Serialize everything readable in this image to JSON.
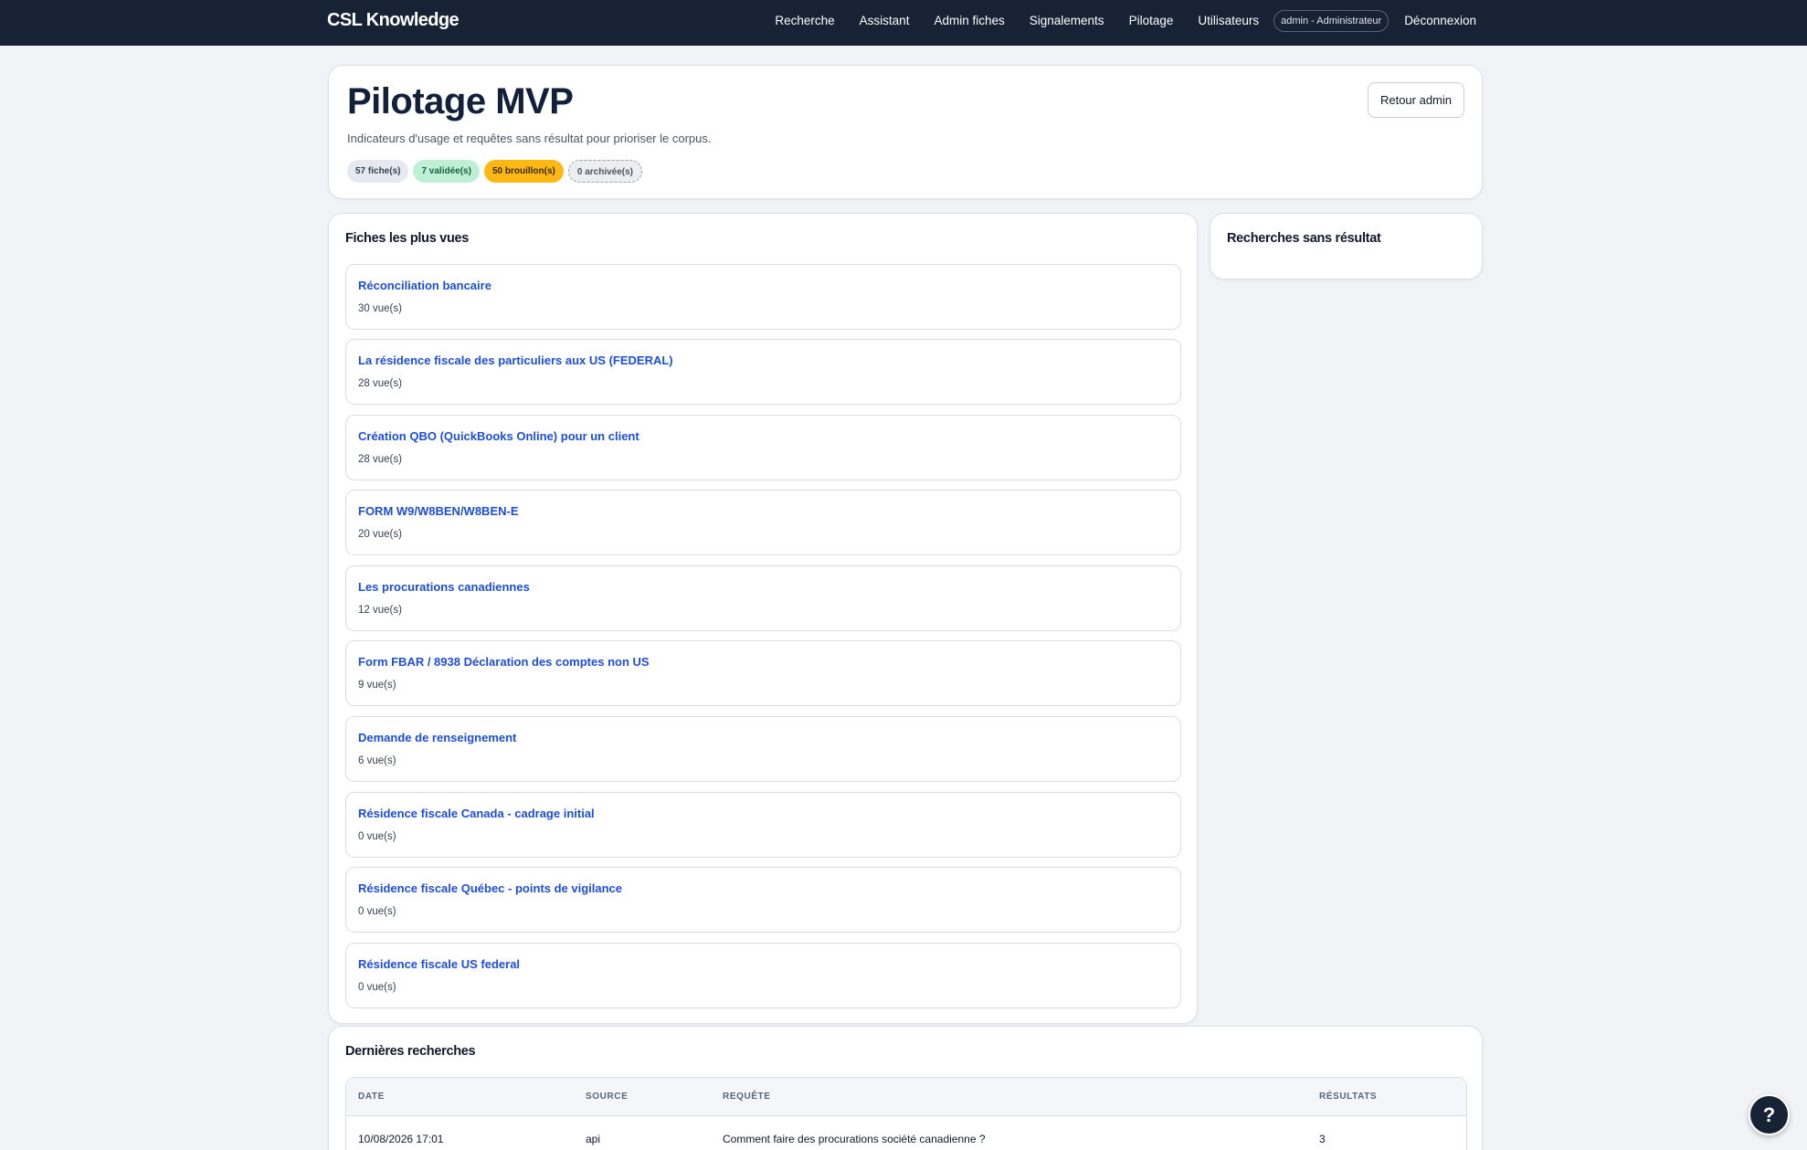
{
  "app": {
    "brand": "CSL Knowledge"
  },
  "nav": {
    "items": [
      "Recherche",
      "Assistant",
      "Admin fiches",
      "Signalements",
      "Pilotage",
      "Utilisateurs"
    ],
    "user": "admin - Administrateur",
    "logout": "Déconnexion"
  },
  "hero": {
    "title": "Pilotage MVP",
    "subtitle": "Indicateurs d'usage et requêtes sans résultat pour prioriser le corpus.",
    "back_label": "Retour admin",
    "badges": {
      "total": "57 fiche(s)",
      "validated": "7 validée(s)",
      "drafts": "50 brouillon(s)",
      "archived": "0 archivée(s)"
    }
  },
  "most_viewed": {
    "title": "Fiches les plus vues",
    "items": [
      {
        "title": "Réconciliation bancaire",
        "views": "30 vue(s)"
      },
      {
        "title": "La résidence fiscale des particuliers aux US (FEDERAL)",
        "views": "28 vue(s)"
      },
      {
        "title": "Création QBO (QuickBooks Online) pour un client",
        "views": "28 vue(s)"
      },
      {
        "title": "FORM W9/W8BEN/W8BEN-E",
        "views": "20 vue(s)"
      },
      {
        "title": "Les procurations canadiennes",
        "views": "12 vue(s)"
      },
      {
        "title": "Form FBAR / 8938 Déclaration des comptes non US",
        "views": "9 vue(s)"
      },
      {
        "title": "Demande de renseignement",
        "views": "6 vue(s)"
      },
      {
        "title": "Résidence fiscale Canada - cadrage initial",
        "views": "0 vue(s)"
      },
      {
        "title": "Résidence fiscale Québec - points de vigilance",
        "views": "0 vue(s)"
      },
      {
        "title": "Résidence fiscale US federal",
        "views": "0 vue(s)"
      }
    ]
  },
  "no_result": {
    "title": "Recherches sans résultat"
  },
  "recent": {
    "title": "Dernières recherches",
    "headers": {
      "date": "DATE",
      "source": "SOURCE",
      "query": "REQUÊTE",
      "results": "RÉSULTATS"
    },
    "rows": [
      {
        "date": "10/08/2026 17:01",
        "source": "api",
        "query": "Comment faire des procurations société canadienne ?",
        "results": "3"
      }
    ]
  },
  "help": {
    "label": "?"
  },
  "colors": {
    "navbar": "#172235",
    "link": "#1d4ed8",
    "draft": "#fdb813",
    "validated": "#bff0d6"
  }
}
